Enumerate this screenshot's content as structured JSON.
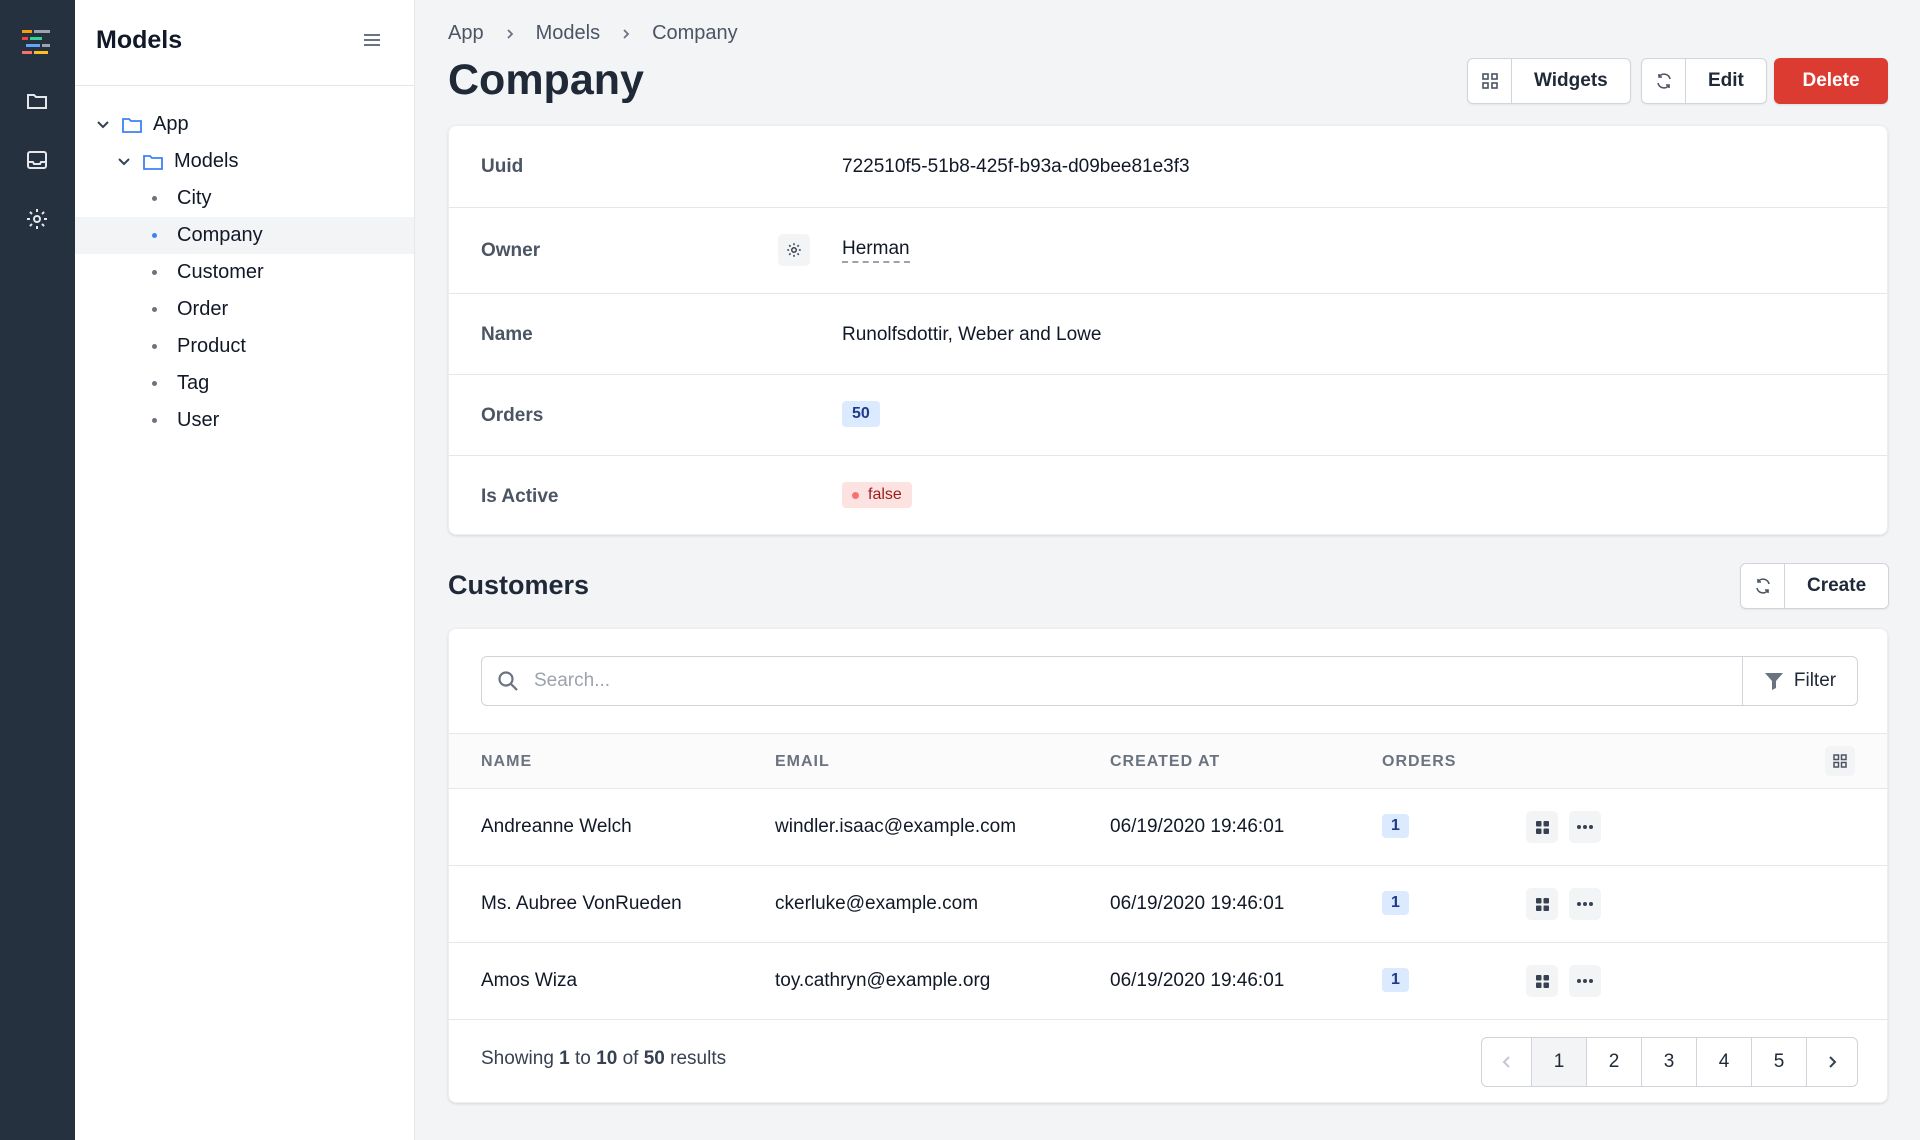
{
  "sidebar": {
    "title": "Models",
    "tree": [
      {
        "label": "App",
        "kind": "folder",
        "level": 0
      },
      {
        "label": "Models",
        "kind": "folder",
        "level": 1
      },
      {
        "label": "City",
        "kind": "item",
        "level": 2
      },
      {
        "label": "Company",
        "kind": "item",
        "level": 2,
        "active": true
      },
      {
        "label": "Customer",
        "kind": "item",
        "level": 2
      },
      {
        "label": "Order",
        "kind": "item",
        "level": 2
      },
      {
        "label": "Product",
        "kind": "item",
        "level": 2
      },
      {
        "label": "Tag",
        "kind": "item",
        "level": 2
      },
      {
        "label": "User",
        "kind": "item",
        "level": 2
      }
    ]
  },
  "breadcrumb": [
    "App",
    "Models",
    "Company"
  ],
  "page": {
    "title": "Company",
    "widgets_label": "Widgets",
    "edit_label": "Edit",
    "delete_label": "Delete"
  },
  "details": {
    "uuid_label": "Uuid",
    "uuid_value": "722510f5-51b8-425f-b93a-d09bee81e3f3",
    "owner_label": "Owner",
    "owner_value": "Herman",
    "name_label": "Name",
    "name_value": "Runolfsdottir, Weber and Lowe",
    "orders_label": "Orders",
    "orders_value": "50",
    "active_label": "Is Active",
    "active_value": "false"
  },
  "customers": {
    "title": "Customers",
    "create_label": "Create",
    "search_placeholder": "Search...",
    "filter_label": "Filter",
    "columns": {
      "name": "NAME",
      "email": "EMAIL",
      "created": "CREATED AT",
      "orders": "ORDERS"
    },
    "rows": [
      {
        "name": "Andreanne Welch",
        "email": "windler.isaac@example.com",
        "created": "06/19/2020 19:46:01",
        "orders": "1"
      },
      {
        "name": "Ms. Aubree VonRueden",
        "email": "ckerluke@example.com",
        "created": "06/19/2020 19:46:01",
        "orders": "1"
      },
      {
        "name": "Amos Wiza",
        "email": "toy.cathryn@example.org",
        "created": "06/19/2020 19:46:01",
        "orders": "1"
      }
    ],
    "footer": {
      "prefix": "Showing",
      "from": "1",
      "to_word": "to",
      "to": "10",
      "of_word": "of",
      "total": "50",
      "suffix": "results"
    },
    "pages": [
      "1",
      "2",
      "3",
      "4",
      "5"
    ]
  },
  "colors": {
    "danger": "#dc3b32",
    "rail": "#263140",
    "accent": "#3b82f6"
  }
}
